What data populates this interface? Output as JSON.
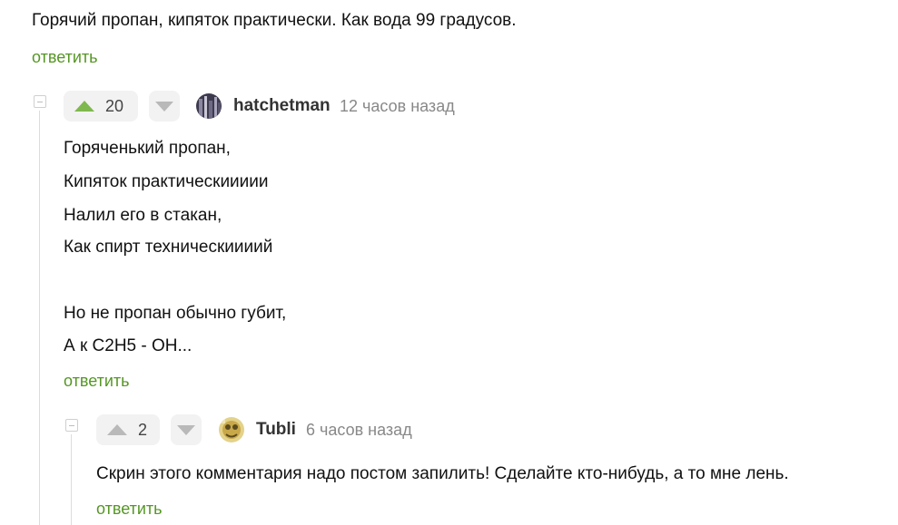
{
  "parent_comment": {
    "text": "Горячий пропан, кипяток практически. Как вода 99 градусов.",
    "reply_label": "ответить"
  },
  "comment1": {
    "rating": "20",
    "username": "hatchetman",
    "time": "12 часов назад",
    "lines": [
      "Горяченький пропан,",
      "Кипяток практическиииии",
      "Налил его в стакан,",
      "Как спирт техническиииий",
      "Но не пропан обычно губит,",
      "А к С2Н5 - ОН..."
    ],
    "reply_label": "ответить"
  },
  "comment2": {
    "rating": "2",
    "username": "Tubli",
    "time": "6 часов назад",
    "text": "Скрин этого комментария надо постом запилить! Сделайте кто-нибудь, а то мне лень.",
    "reply_label": "ответить"
  },
  "colors": {
    "reply_green": "#559624",
    "upvote_green": "#7fb84e",
    "vote_bg": "#f2f2f2"
  }
}
